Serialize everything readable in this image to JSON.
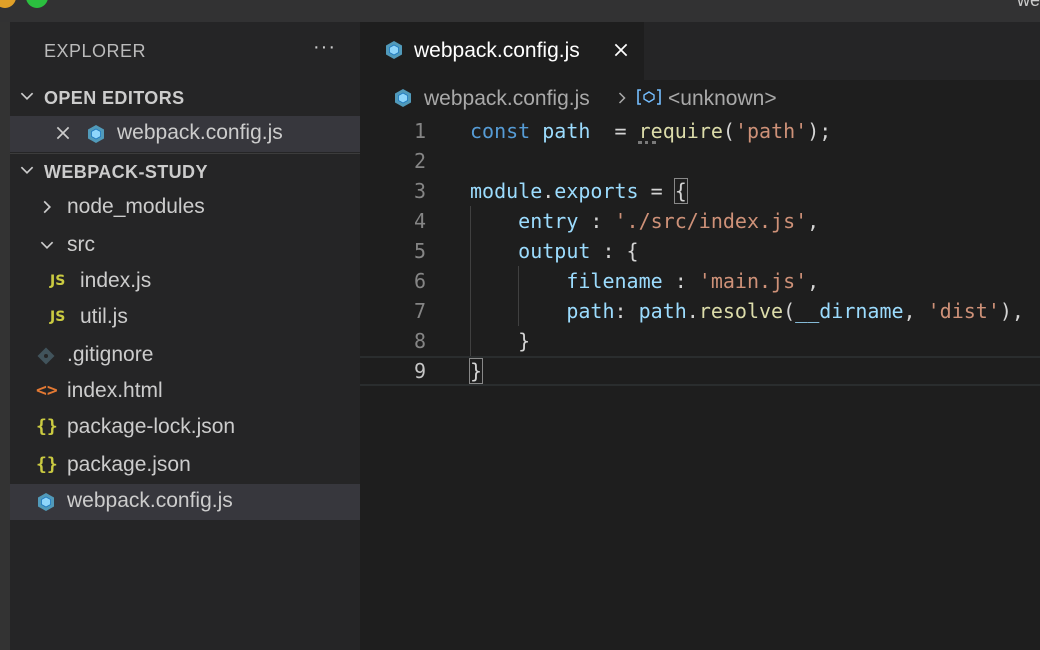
{
  "window": {
    "title_fragment": "we"
  },
  "explorer": {
    "title": "EXPLORER",
    "more_label": "···",
    "open_editors": {
      "header": "OPEN EDITORS",
      "items": [
        {
          "label": "webpack.config.js",
          "icon": "webpack-icon",
          "close_icon": "close-icon"
        }
      ]
    },
    "project": {
      "header": "WEBPACK-STUDY",
      "items": [
        {
          "label": "node_modules",
          "type": "folder",
          "expanded": false
        },
        {
          "label": "src",
          "type": "folder",
          "expanded": true
        },
        {
          "label": "index.js",
          "type": "file",
          "badge": "JS"
        },
        {
          "label": "util.js",
          "type": "file",
          "badge": "JS"
        },
        {
          "label": ".gitignore",
          "type": "file",
          "icon": "git-icon"
        },
        {
          "label": "index.html",
          "type": "file",
          "glyph": "<>"
        },
        {
          "label": "package-lock.json",
          "type": "file",
          "glyph": "{}"
        },
        {
          "label": "package.json",
          "type": "file",
          "glyph": "{}"
        },
        {
          "label": "webpack.config.js",
          "type": "file",
          "icon": "webpack-icon",
          "selected": true
        }
      ]
    }
  },
  "editor": {
    "tab": {
      "label": "webpack.config.js",
      "icon": "webpack-icon",
      "close_icon": "close-icon"
    },
    "breadcrumb": {
      "file": "webpack.config.js",
      "symbol": "<unknown>"
    },
    "current_line": 9,
    "lines": [
      {
        "n": "1",
        "tokens": [
          [
            "kw",
            "const"
          ],
          [
            "punc",
            " "
          ],
          [
            "var",
            "path"
          ],
          [
            "punc",
            "  = "
          ],
          [
            "fn",
            "require"
          ],
          [
            "punc",
            "("
          ],
          [
            "str",
            "'path'"
          ],
          [
            "punc",
            ");"
          ]
        ]
      },
      {
        "n": "2",
        "tokens": []
      },
      {
        "n": "3",
        "tokens": [
          [
            "var",
            "module"
          ],
          [
            "punc",
            "."
          ],
          [
            "var",
            "exports"
          ],
          [
            "punc",
            " = "
          ],
          [
            "punc",
            "{"
          ]
        ]
      },
      {
        "n": "4",
        "tokens": [
          [
            "punc",
            "    "
          ],
          [
            "var",
            "entry"
          ],
          [
            "punc",
            " : "
          ],
          [
            "str",
            "'./src/index.js'"
          ],
          [
            "punc",
            ","
          ]
        ]
      },
      {
        "n": "5",
        "tokens": [
          [
            "punc",
            "    "
          ],
          [
            "var",
            "output"
          ],
          [
            "punc",
            " : {"
          ]
        ]
      },
      {
        "n": "6",
        "tokens": [
          [
            "punc",
            "        "
          ],
          [
            "var",
            "filename"
          ],
          [
            "punc",
            " : "
          ],
          [
            "str",
            "'main.js'"
          ],
          [
            "punc",
            ","
          ]
        ]
      },
      {
        "n": "7",
        "tokens": [
          [
            "punc",
            "        "
          ],
          [
            "var",
            "path"
          ],
          [
            "punc",
            ": "
          ],
          [
            "var",
            "path"
          ],
          [
            "punc",
            "."
          ],
          [
            "fn",
            "resolve"
          ],
          [
            "punc",
            "("
          ],
          [
            "var",
            "__dirname"
          ],
          [
            "punc",
            ", "
          ],
          [
            "str",
            "'dist'"
          ],
          [
            "punc",
            "),"
          ]
        ]
      },
      {
        "n": "8",
        "tokens": [
          [
            "punc",
            "    }"
          ]
        ]
      },
      {
        "n": "9",
        "tokens": [
          [
            "punc",
            "}"
          ]
        ]
      }
    ]
  },
  "colors": {
    "keyword": "#569cd6",
    "variable": "#9cdcfe",
    "function": "#dcdcaa",
    "string": "#ce9178",
    "js_badge": "#cbcb41",
    "webpack_icon": "#519aba",
    "html_glyph": "#e37933",
    "json_glyph": "#cbcb41"
  }
}
